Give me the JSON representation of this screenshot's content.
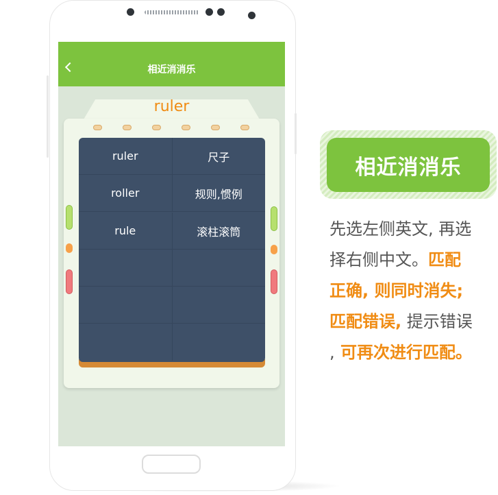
{
  "app": {
    "title": "相近消消乐"
  },
  "game": {
    "current_word": "ruler",
    "rows": [
      {
        "english": "ruler",
        "chinese": "尺子"
      },
      {
        "english": "roller",
        "chinese": "规则,惯例"
      },
      {
        "english": "rule",
        "chinese": "滚柱滚筒"
      },
      {
        "english": "",
        "chinese": ""
      },
      {
        "english": "",
        "chinese": ""
      },
      {
        "english": "",
        "chinese": ""
      }
    ]
  },
  "feature": {
    "badge": "相近消消乐",
    "desc_1": "先选左侧英文, 再选",
    "desc_2": "择右侧中文。",
    "desc_3": "匹配",
    "desc_4": "正确, 则同时消失;",
    "desc_5": "匹配错误,",
    "desc_6": " 提示错误",
    "desc_7": ",",
    "desc_8": " 可再次进行匹配。"
  },
  "colors": {
    "accent_green": "#7dc33e",
    "accent_orange": "#f08c14",
    "board": "#3e5068"
  },
  "icons": {
    "back": "chevron-left-icon"
  }
}
